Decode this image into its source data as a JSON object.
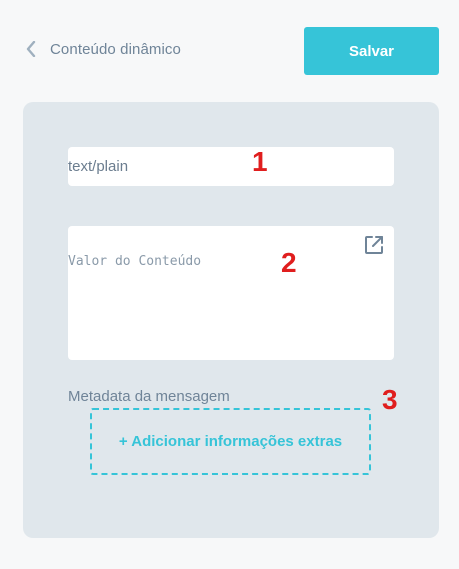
{
  "header": {
    "back_icon": "chevron-left-icon",
    "title": "Conteúdo dinâmico",
    "save_label": "Salvar"
  },
  "form": {
    "content_type_value": "text/plain",
    "content_value_placeholder": "Valor do Conteúdo",
    "expand_icon": "open-in-new-icon",
    "metadata_label": "Metadata da mensagem",
    "add_extra_label": "+ Adicionar informações extras"
  },
  "annotations": [
    "1",
    "2",
    "3"
  ],
  "colors": {
    "accent": "#36c4d8",
    "panel_bg": "#e0e7ec",
    "text_muted": "#6f8498",
    "annotation": "#e01e1e"
  }
}
